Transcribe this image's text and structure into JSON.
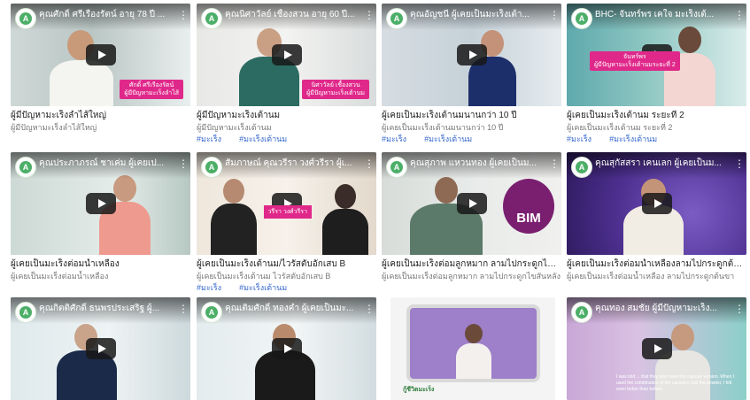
{
  "videos": [
    {
      "title": "คุณศักดิ์ ศรีเรืองรัตน์ อายุ 78 ปี ...",
      "nametag_line1": "ศักดิ์ ศรีเรืองรัตน์",
      "nametag_line2": "ผู้มีปัญหามะเร็งลำไส้",
      "caption": "ผู้มีปัญหามะเร็งลำไส้ใหญ่",
      "sub": "ผู้มีปัญหามะเร็งลำไส้ใหญ่",
      "tags": []
    },
    {
      "title": "คุณนิศาวัลย์ เชื้องสวน อายุ 60 ปี...",
      "nametag_line1": "นิศาวัลย์ เชื้องสวน",
      "nametag_line2": "ผู้มีปัญหามะเร็งเต้านม",
      "caption": "ผู้มีปัญหามะเร็งเต้านม",
      "sub": "ผู้มีปัญหามะเร็งเต้านม",
      "tags": [
        "#มะเร็ง",
        "#มะเร็งเต้านม"
      ]
    },
    {
      "title": "คุณอัญชนี ผู้เคยเป็นมะเร็งเต้า...",
      "caption": "ผู้เคยเป็นมะเร็งเต้านมนานกว่า 10 ปี",
      "sub": "ผู้เคยเป็นมะเร็งเต้านมนานกว่า 10 ปี",
      "tags": [
        "#มะเร็ง",
        "#มะเร็งเต้านม"
      ]
    },
    {
      "title": "BHC- จันทร์พร เคใจ มะเร็งเต้...",
      "nametag_line1": "จันทร์พร",
      "nametag_line2": "ผู้มีปัญหามะเร็งเต้านมระยะที่ 2",
      "caption": "ผู้เคยเป็นมะเร็งเต้านม ระยะที่ 2",
      "sub": "ผู้เคยเป็นมะเร็งเต้านม ระยะที่ 2",
      "tags": [
        "#มะเร็ง",
        "#มะเร็งเต้านม"
      ]
    },
    {
      "title": "คุณประภาภรณ์ ชาเค่ม ผู้เคยเป...",
      "caption": "ผู้เคยเป็นมะเร็งต่อมน้ำเหลือง",
      "sub": "ผู้เคยเป็นมะเร็งต่อมน้ำเหลือง",
      "tags": []
    },
    {
      "title": "สัมภาษณ์ คุณวรีรา วงศ์วรีรา ผู้เ...",
      "nametag_line1": "วรีรา วงศ์วรีรา",
      "caption": "ผู้เคยเป็นมะเร็งเต้านม/ไวรัสตับอักเสบ B",
      "sub": "ผู้เคยเป็นมะเร็งเต้านม ไวรัสตับอักเสบ B",
      "tags": [
        "#มะเร็ง",
        "#มะเร็งเต้านม"
      ]
    },
    {
      "title": "คุณสุภาพ แหวนทอง ผู้เคยเป็นม...",
      "bim_label": "BIM",
      "caption": "ผู้เคยเป็นมะเร็งต่อมลูกหมาก ลามไปกระดูกไขสันหลัง",
      "sub": "ผู้เคยเป็นมะเร็งต่อมลูกหมาก ลามไปกระดูกไขสันหลัง",
      "tags": []
    },
    {
      "title": "คุณสุกัสสรา เคนเลก ผู้เคยเป็นม...",
      "caption": "ผู้เคยเป็นมะเร็งต่อมน้ำเหลืองลามไปกระดูกต้นขา",
      "sub": "ผู้เคยเป็นมะเร็งต่อมน้ำเหลือง ลามไปกระดูกต้นขา",
      "tags": []
    },
    {
      "title": "คุณกิตติศักดิ์ ธนพรประเสริฐ ผู้...",
      "caption": "",
      "sub": "",
      "tags": []
    },
    {
      "title": "คุณเติมศักดิ์ ทองคำ ผู้เคยเป็นมะ...",
      "caption": "",
      "sub": "",
      "tags": []
    },
    {
      "title": "",
      "tv_logo": "กู้ชีวิตมะเร็ง",
      "caption": "",
      "sub": "",
      "tags": []
    },
    {
      "title": "คุณทอง สมชัย ผู้มีปัญหามะเร็ง...",
      "subtitle": "I was told ... that they also have the capsule version. When I used the combination of the capsules and the powder, I felt even better than before.",
      "caption": "",
      "sub": "",
      "tags": []
    }
  ],
  "colors": {
    "accent_pink": "#e0288a",
    "tag_blue": "#3366cc",
    "logo_green": "#4caf68"
  }
}
